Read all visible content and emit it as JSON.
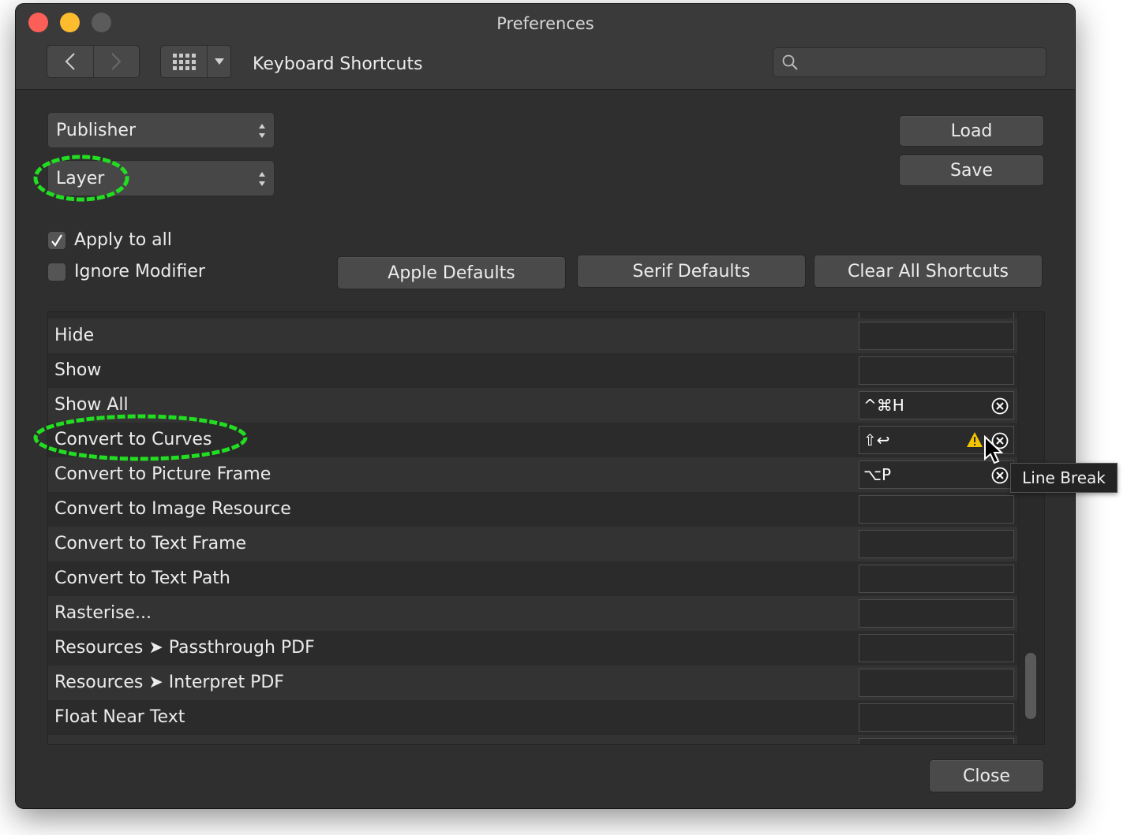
{
  "window": {
    "title": "Preferences",
    "section_title": "Keyboard Shortcuts",
    "search": {
      "placeholder": "",
      "value": ""
    }
  },
  "selectors": {
    "application": "Publisher",
    "category": "Layer"
  },
  "buttons": {
    "load": "Load",
    "save": "Save",
    "apple_defaults": "Apple Defaults",
    "serif_defaults": "Serif Defaults",
    "clear_all": "Clear All Shortcuts",
    "close": "Close"
  },
  "options": {
    "apply_to_all": {
      "label": "Apply to all",
      "checked": true
    },
    "ignore_modifier": {
      "label": "Ignore Modifier",
      "checked": false
    }
  },
  "shortcuts": [
    {
      "name": "Hide",
      "keys": ""
    },
    {
      "name": "Show",
      "keys": ""
    },
    {
      "name": "Show All",
      "keys": "^⌘H"
    },
    {
      "name": "Convert to Curves",
      "keys": "⇧↩",
      "warning": true
    },
    {
      "name": "Convert to Picture Frame",
      "keys": "⌥P"
    },
    {
      "name": "Convert to Image Resource",
      "keys": ""
    },
    {
      "name": "Convert to Text Frame",
      "keys": ""
    },
    {
      "name": "Convert to Text Path",
      "keys": ""
    },
    {
      "name": "Rasterise...",
      "keys": ""
    },
    {
      "name": "Resources ➤ Passthrough PDF",
      "keys": ""
    },
    {
      "name": "Resources ➤ Interpret PDF",
      "keys": ""
    },
    {
      "name": "Float Near Text",
      "keys": ""
    }
  ],
  "tooltip": "Line Break",
  "colors": {
    "annotation_highlight": "#22dd22",
    "warning": "#f5c400"
  }
}
